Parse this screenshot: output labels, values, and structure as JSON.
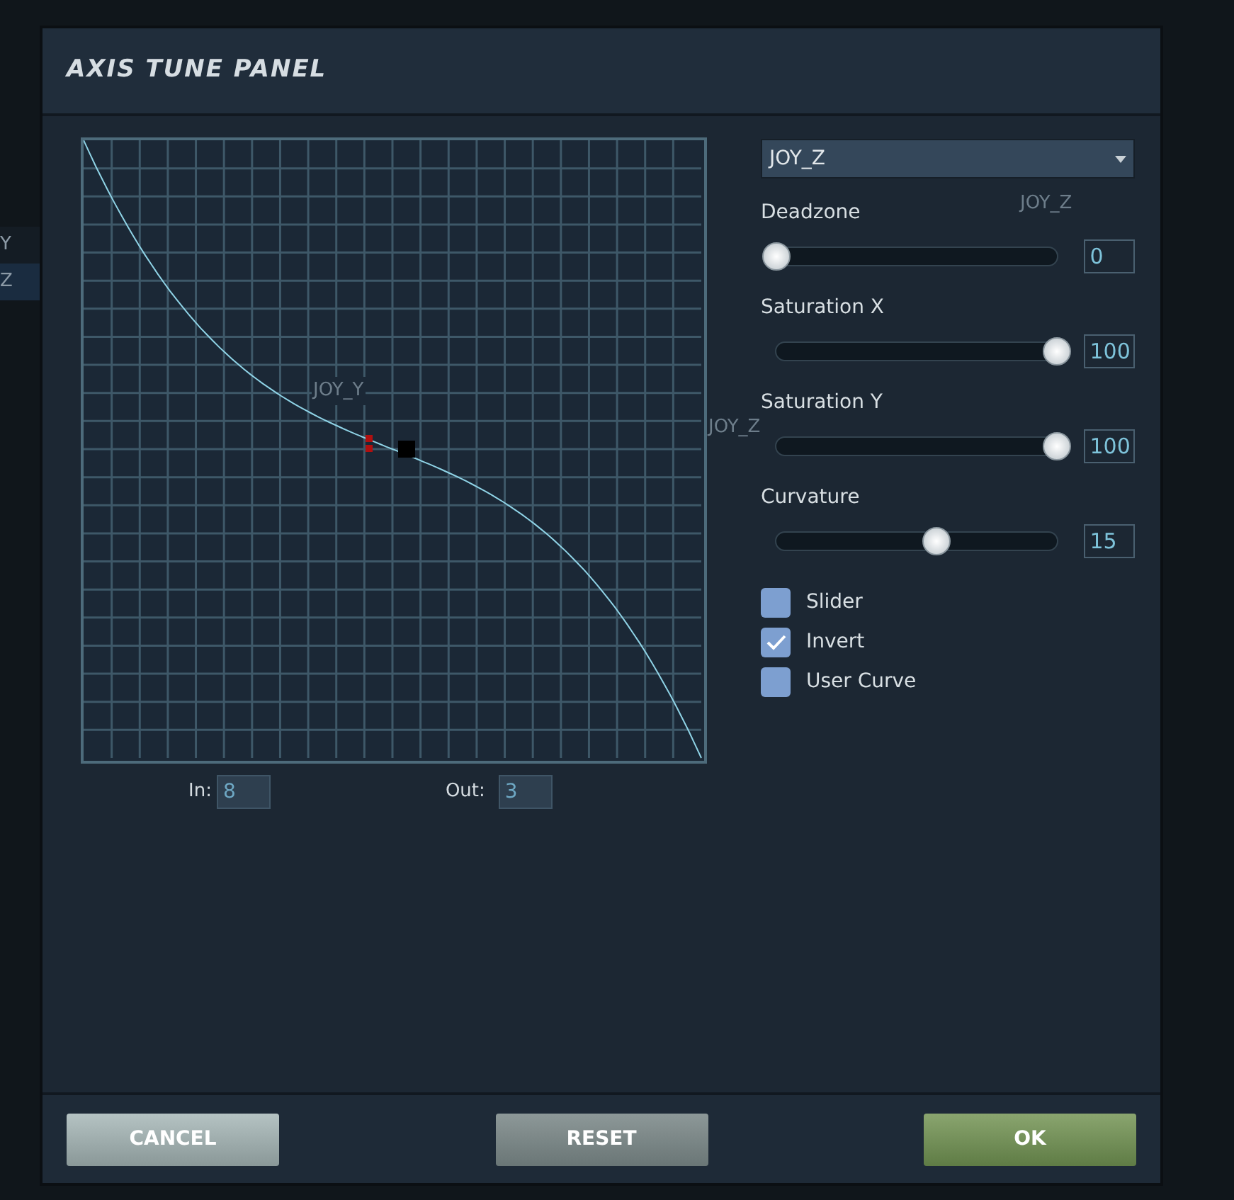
{
  "background_list": [
    {
      "label": "Y",
      "selected": false
    },
    {
      "label": "Z",
      "selected": true
    }
  ],
  "background_labels": [
    "JOY_Y",
    "JOY_Z",
    "JOY_Z"
  ],
  "window": {
    "title": "AXIS TUNE PANEL"
  },
  "graph": {
    "in_label": "In:",
    "in_value": "8",
    "out_label": "Out:",
    "out_value": "3"
  },
  "axis_dropdown": {
    "value": "JOY_Z"
  },
  "sliders": [
    {
      "label": "Deadzone",
      "level": 0,
      "reading": "0"
    },
    {
      "label": "Saturation X",
      "level": 1,
      "reading": "100"
    },
    {
      "label": "Saturation Y",
      "level": 1,
      "reading": "100"
    },
    {
      "label": "Curvature",
      "level": 0.57,
      "reading": "15"
    }
  ],
  "options": [
    {
      "label": "Slider",
      "checked": false
    },
    {
      "label": "Invert",
      "checked": true
    },
    {
      "label": "User Curve",
      "checked": false
    }
  ],
  "buttons": [
    {
      "label": "CANCEL",
      "kind": "cancel"
    },
    {
      "label": "RESET",
      "kind": "reset"
    },
    {
      "label": "OK",
      "kind": "ok"
    }
  ]
}
